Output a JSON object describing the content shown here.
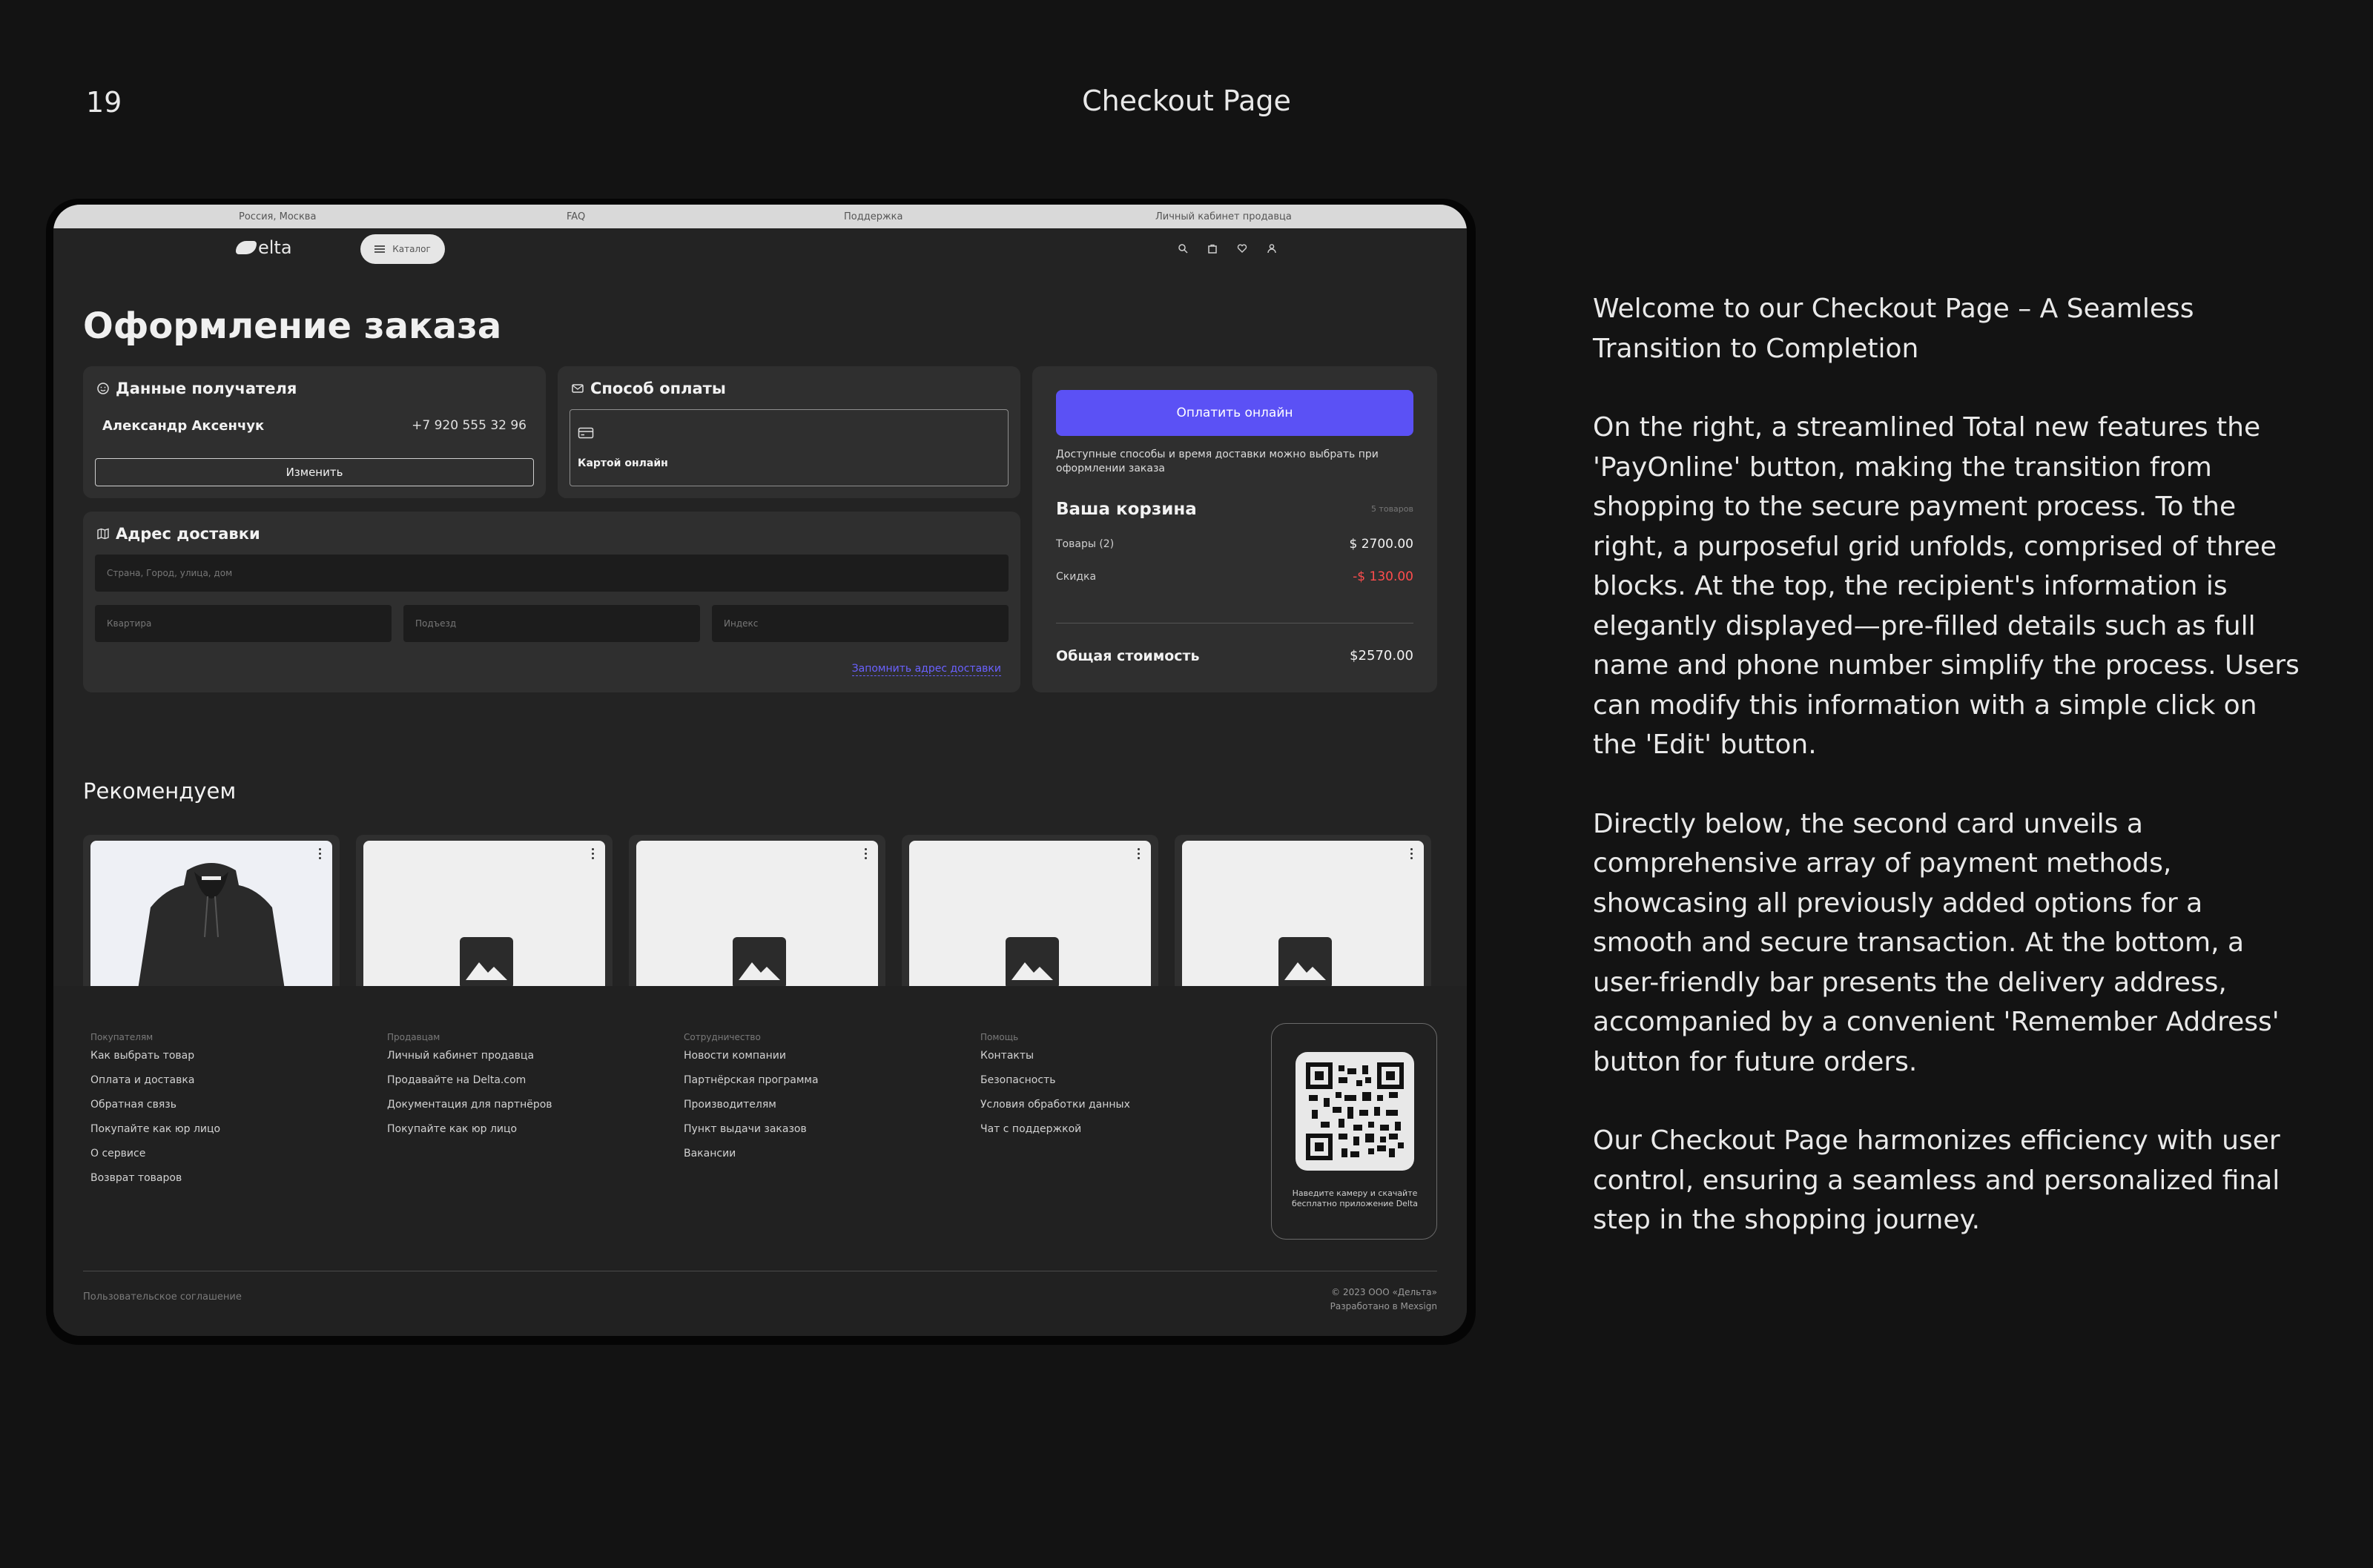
{
  "slide": {
    "number": "19",
    "title": "Checkout Page"
  },
  "screen": {
    "topbar": {
      "location": "Россия, Москва",
      "faq": "FAQ",
      "support": "Поддержка",
      "seller_cabinet": "Личный кабинет продавца"
    },
    "navbar": {
      "logo_text": "elta",
      "catalog_label": "Каталог",
      "icons": [
        "search-icon",
        "bag-icon",
        "heart-icon",
        "user-icon"
      ]
    },
    "page_heading": "Оформление заказа",
    "recipient": {
      "title": "Данные получателя",
      "name": "Александр Аксенчук",
      "phone": "+7 920 555 32 96",
      "edit_label": "Изменить"
    },
    "payment": {
      "title": "Способ оплаты",
      "option_label": "Картой онлайн"
    },
    "address": {
      "title": "Адрес доставки",
      "street_placeholder": "Страна, Город, улица, дом",
      "apartment_placeholder": "Квартира",
      "entrance_placeholder": "Подъезд",
      "zip_placeholder": "Индекс",
      "remember_label": "Запомнить адрес доставки"
    },
    "summary": {
      "pay_button": "Оплатить онлайн",
      "delivery_note": "Доступные способы и время доставки можно выбрать при оформлении заказа",
      "cart_title": "Ваша корзина",
      "cart_count": "5 товаров",
      "items_label": "Товары (2)",
      "items_value": "$ 2700.00",
      "discount_label": "Скидка",
      "discount_value": "-$ 130.00",
      "total_label": "Общая стоимость",
      "total_value": "$2570.00",
      "accent_color": "#5b51f5",
      "discount_color": "#ff4d4d"
    },
    "recommended": {
      "title": "Рекомендуем",
      "products": [
        {
          "image": "hoodie-photo"
        },
        {
          "image": "image-placeholder-icon"
        },
        {
          "image": "image-placeholder-icon"
        },
        {
          "image": "image-placeholder-icon"
        },
        {
          "image": "image-placeholder-icon"
        }
      ]
    },
    "footer": {
      "columns": [
        {
          "heading": "Покупателям",
          "links": [
            "Как выбрать товар",
            "Оплата и доставка",
            "Обратная связь",
            "Покупайте как юр лицо",
            "О сервисе",
            "Возврат товаров"
          ]
        },
        {
          "heading": "Продавцам",
          "links": [
            "Личный кабинет продавца",
            "Продавайте на Delta.com",
            "Документация для партнёров",
            "Покупайте как юр лицо"
          ]
        },
        {
          "heading": "Сотрудничество",
          "links": [
            "Новости компании",
            "Партнёрская программа",
            "Производителям",
            "Пункт выдачи заказов",
            "Вакансии"
          ]
        },
        {
          "heading": "Помощь",
          "links": [
            "Контакты",
            "Безопасность",
            "Условия обработки данных",
            "Чат с поддержкой"
          ]
        }
      ],
      "qr_caption_line1": "Наведите камеру и скачайте",
      "qr_caption_line2": "бесплатно приложение Delta",
      "terms": "Пользовательское соглашение",
      "copyright": "© 2023 ООО «Дельта»",
      "credit": "Разработано в Mexsign"
    }
  },
  "description": [
    "Welcome to our Checkout Page – A Seamless Transition to Completion",
    "On the right, a streamlined Total new features the 'PayOnline' button, making the transition from shopping to the secure payment process. To the right, a purposeful grid unfolds, comprised of three blocks. At the top, the recipient's information is elegantly displayed—pre-filled details such as full name and phone number simplify the process. Users can modify this information with a simple click on the 'Edit' button.",
    "Directly below, the second card unveils a comprehensive array of payment methods, showcasing all previously added options for a smooth and secure transaction. At the bottom, a user-friendly bar presents the delivery address, accompanied by a convenient 'Remember Address' button for future orders.",
    "Our Checkout Page harmonizes efficiency with user control, ensuring a seamless and personalized final step in the shopping journey."
  ]
}
